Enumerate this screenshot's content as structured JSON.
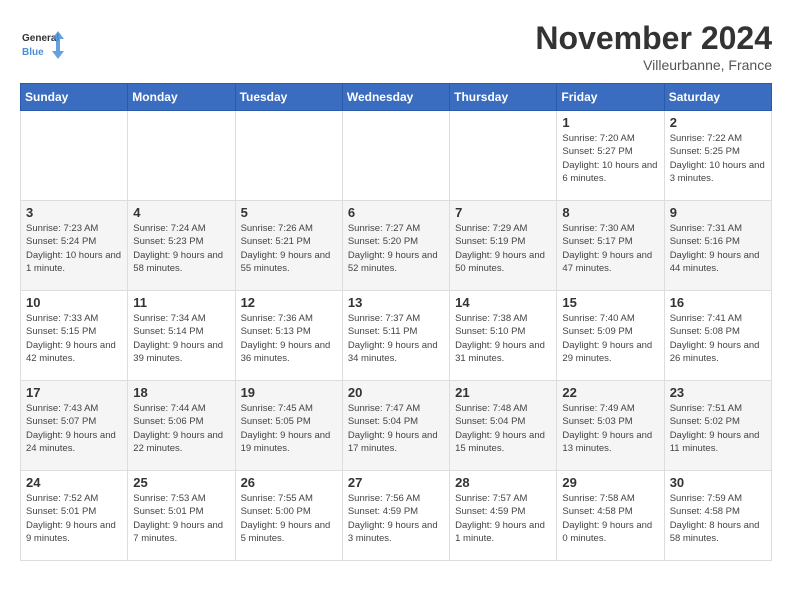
{
  "header": {
    "logo_general": "General",
    "logo_blue": "Blue",
    "month_year": "November 2024",
    "location": "Villeurbanne, France"
  },
  "days_of_week": [
    "Sunday",
    "Monday",
    "Tuesday",
    "Wednesday",
    "Thursday",
    "Friday",
    "Saturday"
  ],
  "weeks": [
    [
      {
        "day": "",
        "info": ""
      },
      {
        "day": "",
        "info": ""
      },
      {
        "day": "",
        "info": ""
      },
      {
        "day": "",
        "info": ""
      },
      {
        "day": "",
        "info": ""
      },
      {
        "day": "1",
        "info": "Sunrise: 7:20 AM\nSunset: 5:27 PM\nDaylight: 10 hours and 6 minutes."
      },
      {
        "day": "2",
        "info": "Sunrise: 7:22 AM\nSunset: 5:25 PM\nDaylight: 10 hours and 3 minutes."
      }
    ],
    [
      {
        "day": "3",
        "info": "Sunrise: 7:23 AM\nSunset: 5:24 PM\nDaylight: 10 hours and 1 minute."
      },
      {
        "day": "4",
        "info": "Sunrise: 7:24 AM\nSunset: 5:23 PM\nDaylight: 9 hours and 58 minutes."
      },
      {
        "day": "5",
        "info": "Sunrise: 7:26 AM\nSunset: 5:21 PM\nDaylight: 9 hours and 55 minutes."
      },
      {
        "day": "6",
        "info": "Sunrise: 7:27 AM\nSunset: 5:20 PM\nDaylight: 9 hours and 52 minutes."
      },
      {
        "day": "7",
        "info": "Sunrise: 7:29 AM\nSunset: 5:19 PM\nDaylight: 9 hours and 50 minutes."
      },
      {
        "day": "8",
        "info": "Sunrise: 7:30 AM\nSunset: 5:17 PM\nDaylight: 9 hours and 47 minutes."
      },
      {
        "day": "9",
        "info": "Sunrise: 7:31 AM\nSunset: 5:16 PM\nDaylight: 9 hours and 44 minutes."
      }
    ],
    [
      {
        "day": "10",
        "info": "Sunrise: 7:33 AM\nSunset: 5:15 PM\nDaylight: 9 hours and 42 minutes."
      },
      {
        "day": "11",
        "info": "Sunrise: 7:34 AM\nSunset: 5:14 PM\nDaylight: 9 hours and 39 minutes."
      },
      {
        "day": "12",
        "info": "Sunrise: 7:36 AM\nSunset: 5:13 PM\nDaylight: 9 hours and 36 minutes."
      },
      {
        "day": "13",
        "info": "Sunrise: 7:37 AM\nSunset: 5:11 PM\nDaylight: 9 hours and 34 minutes."
      },
      {
        "day": "14",
        "info": "Sunrise: 7:38 AM\nSunset: 5:10 PM\nDaylight: 9 hours and 31 minutes."
      },
      {
        "day": "15",
        "info": "Sunrise: 7:40 AM\nSunset: 5:09 PM\nDaylight: 9 hours and 29 minutes."
      },
      {
        "day": "16",
        "info": "Sunrise: 7:41 AM\nSunset: 5:08 PM\nDaylight: 9 hours and 26 minutes."
      }
    ],
    [
      {
        "day": "17",
        "info": "Sunrise: 7:43 AM\nSunset: 5:07 PM\nDaylight: 9 hours and 24 minutes."
      },
      {
        "day": "18",
        "info": "Sunrise: 7:44 AM\nSunset: 5:06 PM\nDaylight: 9 hours and 22 minutes."
      },
      {
        "day": "19",
        "info": "Sunrise: 7:45 AM\nSunset: 5:05 PM\nDaylight: 9 hours and 19 minutes."
      },
      {
        "day": "20",
        "info": "Sunrise: 7:47 AM\nSunset: 5:04 PM\nDaylight: 9 hours and 17 minutes."
      },
      {
        "day": "21",
        "info": "Sunrise: 7:48 AM\nSunset: 5:04 PM\nDaylight: 9 hours and 15 minutes."
      },
      {
        "day": "22",
        "info": "Sunrise: 7:49 AM\nSunset: 5:03 PM\nDaylight: 9 hours and 13 minutes."
      },
      {
        "day": "23",
        "info": "Sunrise: 7:51 AM\nSunset: 5:02 PM\nDaylight: 9 hours and 11 minutes."
      }
    ],
    [
      {
        "day": "24",
        "info": "Sunrise: 7:52 AM\nSunset: 5:01 PM\nDaylight: 9 hours and 9 minutes."
      },
      {
        "day": "25",
        "info": "Sunrise: 7:53 AM\nSunset: 5:01 PM\nDaylight: 9 hours and 7 minutes."
      },
      {
        "day": "26",
        "info": "Sunrise: 7:55 AM\nSunset: 5:00 PM\nDaylight: 9 hours and 5 minutes."
      },
      {
        "day": "27",
        "info": "Sunrise: 7:56 AM\nSunset: 4:59 PM\nDaylight: 9 hours and 3 minutes."
      },
      {
        "day": "28",
        "info": "Sunrise: 7:57 AM\nSunset: 4:59 PM\nDaylight: 9 hours and 1 minute."
      },
      {
        "day": "29",
        "info": "Sunrise: 7:58 AM\nSunset: 4:58 PM\nDaylight: 9 hours and 0 minutes."
      },
      {
        "day": "30",
        "info": "Sunrise: 7:59 AM\nSunset: 4:58 PM\nDaylight: 8 hours and 58 minutes."
      }
    ]
  ]
}
